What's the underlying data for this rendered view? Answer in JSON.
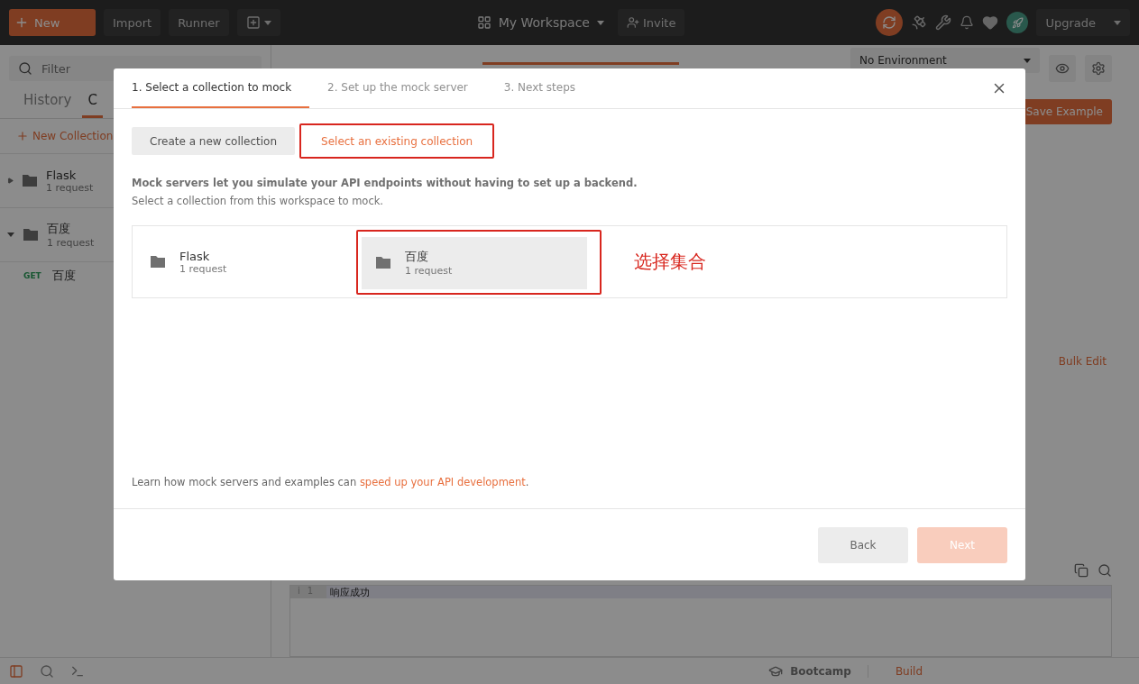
{
  "toolbar": {
    "new_button": "New",
    "buttons": [
      "Import",
      "Runner"
    ],
    "workspace": "My Workspace",
    "invite": "Invite",
    "upgrade": "Upgrade"
  },
  "sidebar": {
    "search": {
      "placeholder": "Filter"
    },
    "tabs": [
      {
        "label": "History",
        "selected": false
      },
      {
        "label": "C",
        "selected": true
      }
    ],
    "new_collection": "New Collection",
    "collections": [
      {
        "name": "Flask",
        "count": "1 request",
        "expanded": false
      },
      {
        "name": "百度",
        "count": "1 request",
        "expanded": true,
        "requests": [
          {
            "method": "GET",
            "name": "百度"
          }
        ]
      }
    ]
  },
  "content": {
    "environment": "No Environment",
    "save_button": "Save Example",
    "bulk_edit": "Bulk Edit",
    "editor_lines": [
      {
        "marker": "i",
        "number": "1",
        "text": "响应成功"
      }
    ]
  },
  "status_bar": {
    "bootcamp": "Bootcamp",
    "build": "Build"
  },
  "modal": {
    "steps": [
      {
        "label": "1. Select a collection to mock",
        "selected": true
      },
      {
        "label": "2. Set up the mock server",
        "selected": false
      },
      {
        "label": "3. Next steps",
        "selected": false
      }
    ],
    "modes": [
      {
        "label": "Create a new collection",
        "selected": false,
        "marked": false
      },
      {
        "label": "Select an existing collection",
        "selected": true,
        "marked": true
      }
    ],
    "description": "Mock servers let you simulate your API endpoints without having to set up a backend.",
    "hint": "Select a collection from this workspace to mock.",
    "collections": [
      {
        "name": "Flask",
        "count": "1 request",
        "selected": false,
        "marked": false
      },
      {
        "name": "百度",
        "count": "1 request",
        "selected": true,
        "marked": true
      }
    ],
    "annotation": "选择集合",
    "learn_text": "Learn how mock servers and examples can ",
    "learn_link": "speed up your API development",
    "learn_end": ".",
    "buttons": [
      {
        "label": "Back",
        "kind": "secondary",
        "disabled": false
      },
      {
        "label": "Next",
        "kind": "primary",
        "disabled": true
      }
    ]
  }
}
